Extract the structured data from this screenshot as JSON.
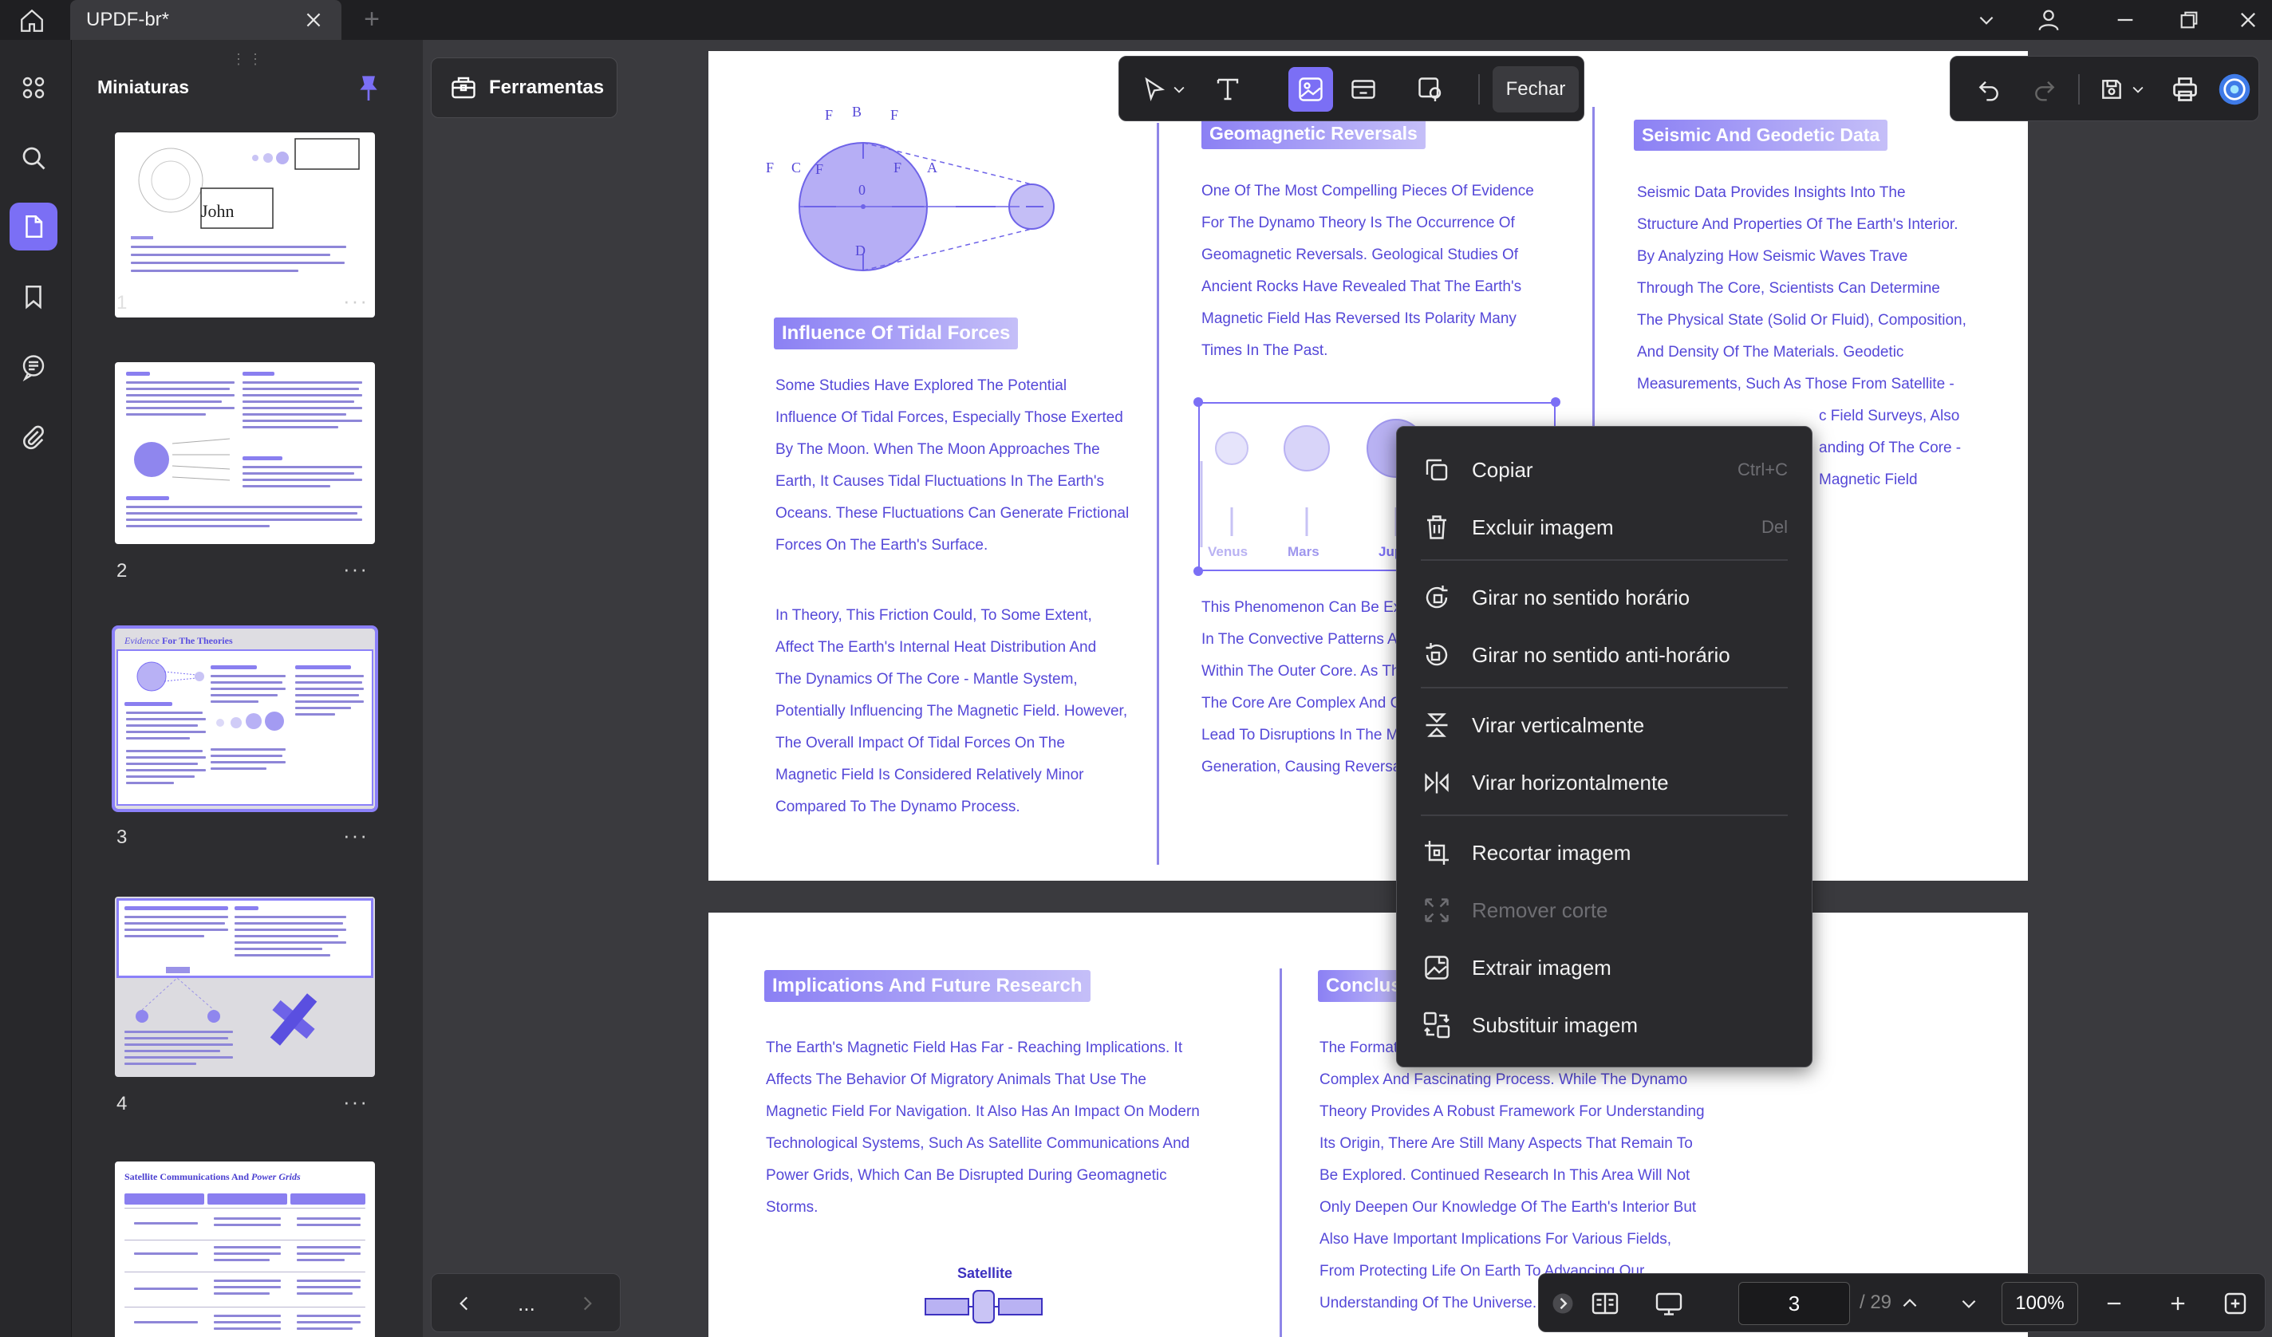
{
  "window": {
    "tab_title": "UPDF-br*"
  },
  "sidebar": {
    "title": "Miniaturas",
    "pages": [
      "1",
      "2",
      "3",
      "4"
    ]
  },
  "tools": {
    "label": "Ferramentas"
  },
  "edit_toolbar": {
    "close_label": "Fechar"
  },
  "document": {
    "page_top": {
      "diagram_labels": {
        "fb": "B",
        "ff": "F",
        "fg": "F",
        "fd": "D",
        "c": "C",
        "o": "0",
        "a": "A",
        "fr_left": "F",
        "fg_left": "F",
        "fr_mid": "F"
      },
      "tidal_heading": "Influence Of Tidal Forces",
      "tidal_p1": [
        "Some Studies Have Explored The Potential",
        "Influence Of Tidal Forces, Especially Those Exerted",
        "By The Moon. When The Moon Approaches The",
        "Earth, It Causes Tidal Fluctuations In The Earth's",
        "Oceans. These Fluctuations Can Generate Frictional",
        "Forces On The Earth's Surface."
      ],
      "tidal_p2": [
        " In Theory, This Friction Could, To Some Extent,",
        "Affect The Earth's Internal Heat Distribution And",
        "The Dynamics Of The Core - Mantle System,",
        "Potentially Influencing The Magnetic Field. However,",
        "The Overall Impact Of Tidal Forces On The",
        "Magnetic Field Is Considered Relatively Minor",
        "Compared To The Dynamo Process."
      ],
      "geo_heading": "Geomagnetic Reversals",
      "geo_p1": [
        "One Of The Most Compelling Pieces Of Evidence",
        "For The Dynamo Theory Is The Occurrence Of",
        "Geomagnetic Reversals. Geological Studies Of",
        "Ancient Rocks Have Revealed That The Earth's",
        "Magnetic Field Has Reversed Its Polarity Many",
        "Times In The Past."
      ],
      "planets": [
        "Venus",
        "Mars",
        "Jupi"
      ],
      "geo_p2": [
        "This Phenomenon Can Be Ex",
        "In The Convective Patterns A",
        "Within The Outer Core. As Th",
        "The Core Are Complex And C",
        "Lead To Disruptions In The M",
        "Generation, Causing Reversa"
      ],
      "seismic_heading": "Seismic And Geodetic Data",
      "seismic_p": [
        "Seismic Data Provides Insights Into The",
        "Structure And Properties Of The Earth's Interior.",
        "By Analyzing How Seismic Waves Trave",
        "Through The Core, Scientists Can Determine",
        "The Physical State (Solid Or Fluid), Composition,",
        "And Density Of The Materials. Geodetic",
        "Measurements, Such As Those From Satellite -",
        "c Field Surveys, Also",
        "anding Of The Core -",
        " Magnetic Field"
      ]
    },
    "page_bottom": {
      "impl_heading": "Implications And Future Research",
      "impl_p": [
        "The Earth's Magnetic Field Has Far - Reaching Implications. It",
        "Affects The Behavior Of Migratory Animals That Use The",
        "Magnetic Field For Navigation. It Also Has An Impact On Modern",
        "Technological Systems, Such As Satellite Communications And",
        "Power Grids, Which Can Be Disrupted During Geomagnetic",
        "Storms."
      ],
      "satellite_label": "Satellite",
      "concl_heading": "Conclus",
      "concl_p": [
        "The Format",
        "Complex And Fascinating Process. While The Dynamo",
        "Theory Provides A Robust Framework For Understanding",
        "Its Origin, There Are Still Many Aspects That Remain To",
        "Be Explored. Continued Research In This Area Will Not",
        "Only Deepen Our Knowledge Of The Earth's Interior But",
        "Also Have Important Implications For Various Fields,",
        "From Protecting Life On Earth To Advancing Our",
        "Understanding Of The Universe."
      ]
    }
  },
  "context_menu": {
    "copy": "Copiar",
    "copy_shortcut": "Ctrl+C",
    "delete": "Excluir imagem",
    "delete_shortcut": "Del",
    "rotate_cw": "Girar no sentido horário",
    "rotate_ccw": "Girar no sentido anti-horário",
    "flip_v": "Virar verticalmente",
    "flip_h": "Virar horizontalmente",
    "crop": "Recortar imagem",
    "remove_crop": "Remover corte",
    "extract": "Extrair imagem",
    "replace": "Substituir imagem"
  },
  "navigation": {
    "current_page": "3",
    "total_pages": "/ 29",
    "zoom": "100%",
    "more": "..."
  },
  "thumb_texts": {
    "p1_name": "John",
    "p3_title_italic": "Evidence",
    "p3_title_rest": " For The Theories",
    "p5_title": "Satellite Communications And ",
    "p5_title_italic": "Power Grids"
  },
  "colors": {
    "accent": "#7b6ff5",
    "doc_text": "#5548d8",
    "heading_pill": "#8b80f4"
  }
}
